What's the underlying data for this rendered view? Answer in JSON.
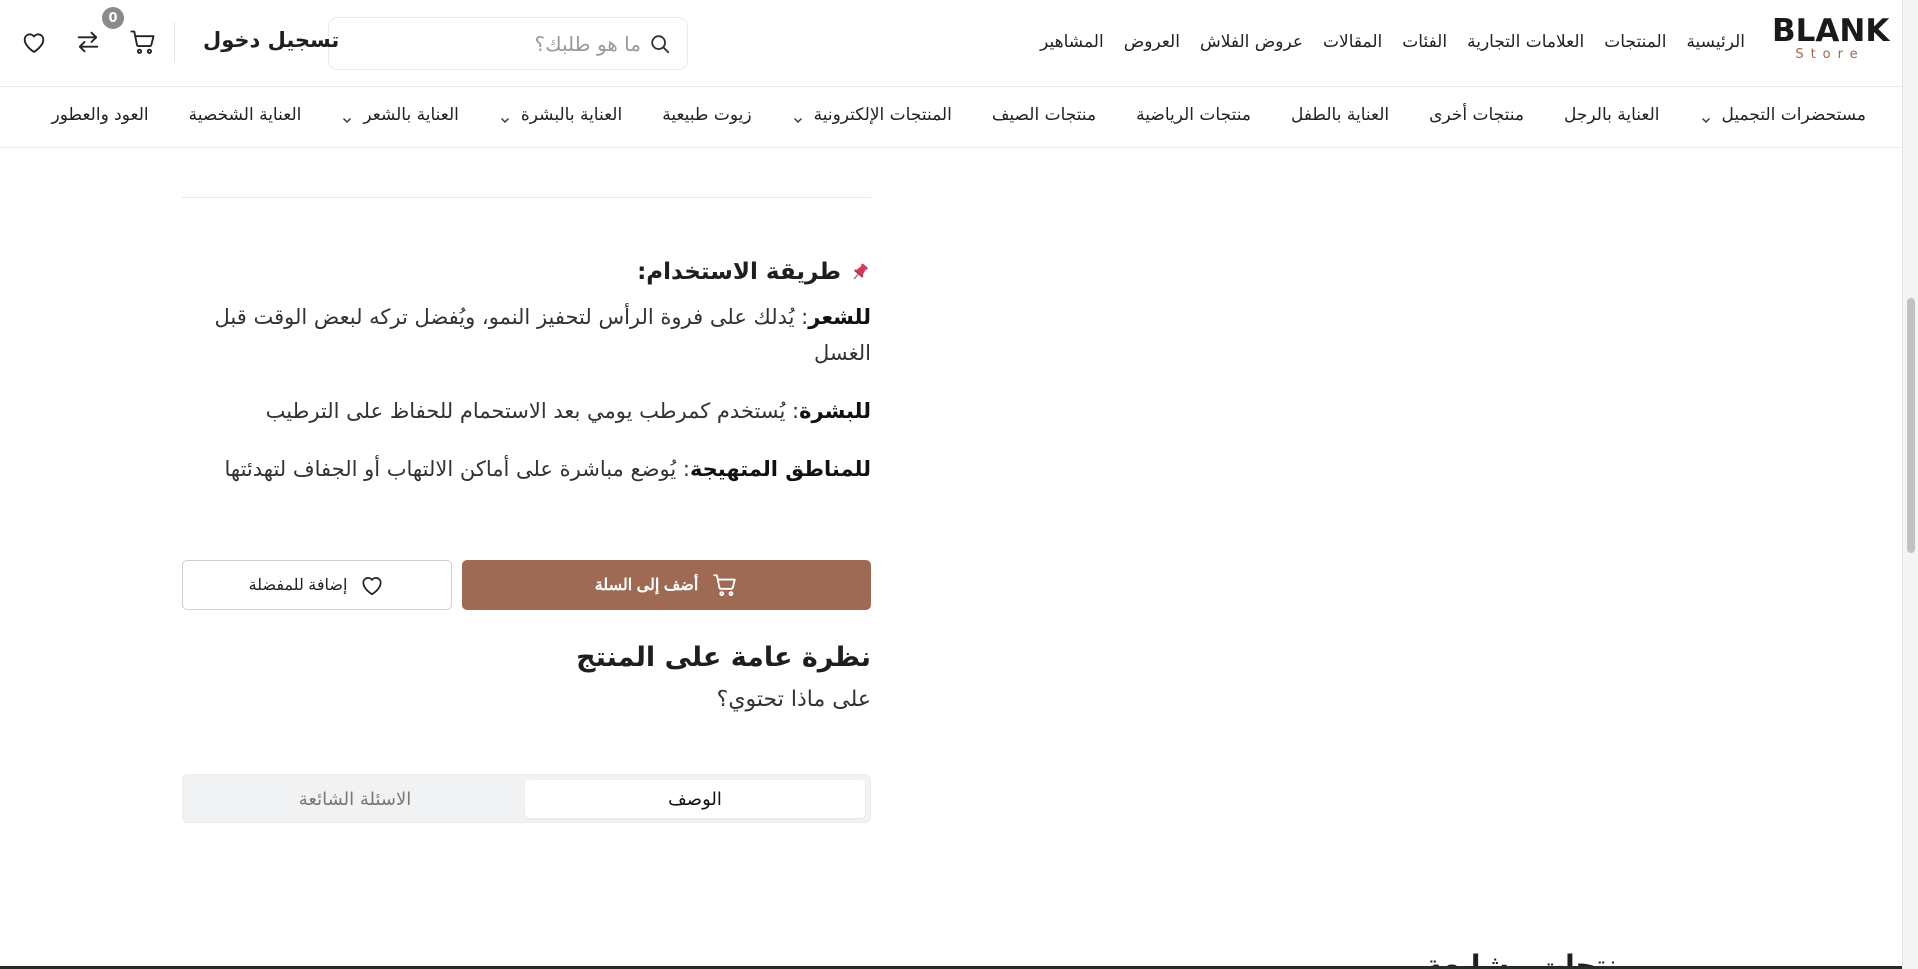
{
  "header": {
    "logo": {
      "main": "BLANK",
      "sub": "Store"
    },
    "nav": [
      "الرئيسية",
      "المنتجات",
      "العلامات التجارية",
      "الفئات",
      "المقالات",
      "عروض الفلاش",
      "العروض",
      "المشاهير"
    ],
    "search": {
      "placeholder": "ما هو طلبك؟"
    },
    "login_label": "تسجيل دخول",
    "cart_count": "0",
    "icons": {
      "cart": "cart-icon",
      "compare": "compare-arrows-icon",
      "wishlist": "heart-icon",
      "search": "search-icon"
    }
  },
  "categories": [
    {
      "label": "مستحضرات التجميل",
      "has_dropdown": true
    },
    {
      "label": "العناية بالرجل",
      "has_dropdown": false
    },
    {
      "label": "منتجات أخرى",
      "has_dropdown": false
    },
    {
      "label": "العناية بالطفل",
      "has_dropdown": false
    },
    {
      "label": "منتجات الرياضية",
      "has_dropdown": false
    },
    {
      "label": "منتجات الصيف",
      "has_dropdown": false
    },
    {
      "label": "المنتجات الإلكترونية",
      "has_dropdown": true
    },
    {
      "label": "زيوت طبيعية",
      "has_dropdown": false
    },
    {
      "label": "العناية بالبشرة",
      "has_dropdown": true
    },
    {
      "label": "العناية بالشعر",
      "has_dropdown": true
    },
    {
      "label": "العناية الشخصية",
      "has_dropdown": false
    },
    {
      "label": "العود والعطور",
      "has_dropdown": false
    }
  ],
  "usage": {
    "title": "طريقة الاستخدام:",
    "items": [
      {
        "label": "للشعر",
        "text": ": يُدلك على فروة الرأس لتحفيز النمو، ويُفضل تركه لبعض الوقت قبل الغسل"
      },
      {
        "label": "للبشرة",
        "text": ": يُستخدم كمرطب يومي بعد الاستحمام للحفاظ على الترطيب"
      },
      {
        "label": "للمناطق المتهيجة",
        "text": ": يُوضع مباشرة على أماكن الالتهاب أو الجفاف لتهدئتها"
      }
    ]
  },
  "actions": {
    "add_to_cart": "أضف إلى السلة",
    "add_to_wishlist": "إضافة للمفضلة"
  },
  "overview": {
    "title": "نظرة عامة على المنتج",
    "subtitle": "على ماذا تحتوي؟"
  },
  "tabs": {
    "description": "الوصف",
    "faq": "الاسئلة الشائعة",
    "active": "description"
  },
  "partial_section_heading": "منتجات مشابهة",
  "colors": {
    "accent": "#9f6a53",
    "logo_sub": "#a0684f",
    "text": "#1f1f1f",
    "muted": "#777777",
    "tab_bg": "#f1f2f4",
    "pin": "#d9345a"
  }
}
